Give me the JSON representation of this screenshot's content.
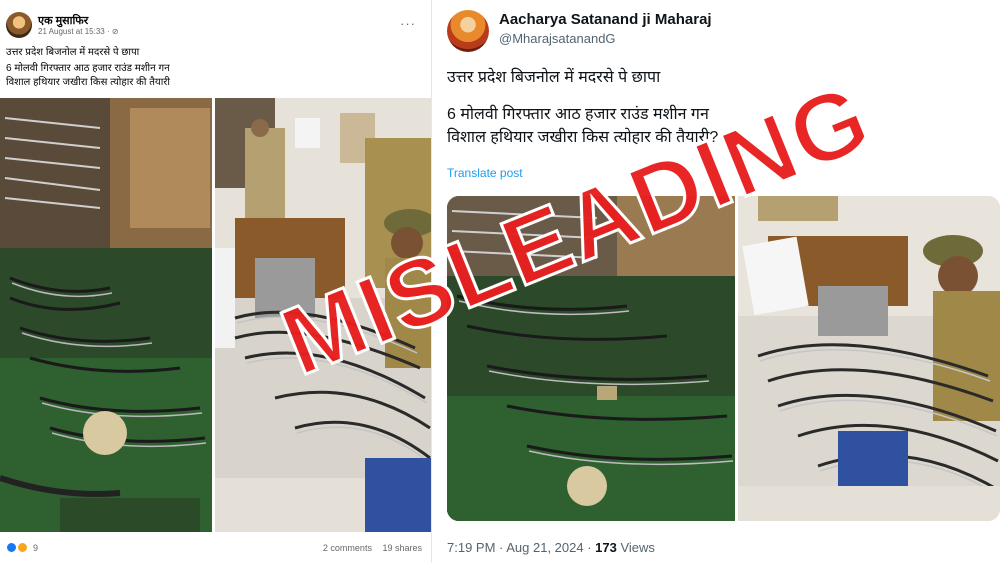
{
  "facebook_post": {
    "author": "एक मुसाफिर",
    "meta": "21 August at 15:33 · ⊘",
    "more_label": "···",
    "text_line1": "उत्तर प्रदेश बिजनोल में मदरसे पे छापा",
    "text_line2": "6 मोलवी गिरफ्तार आठ हजार राउंड मशीन गन",
    "text_line3": "विशाल हथियार जखीरा किस त्योहार की तैयारी",
    "reaction_count": "9",
    "comments": "2 comments",
    "shares": "19 shares"
  },
  "tweet": {
    "name": "Aacharya Satanand ji Maharaj",
    "handle": "@MharajsatanandG",
    "text_line1": "उत्तर प्रदेश बिजनोल में मदरसे पे छापा",
    "text_line2": "6 मोलवी गिरफ्तार आठ हजार राउंड मशीन गन",
    "text_line3": "विशाल हथियार जखीरा किस त्योहार की तैयारी?",
    "translate_label": "Translate post",
    "timestamp": "7:19 PM · Aug 21, 2024 · ",
    "views_count": "173",
    "views_label": " Views"
  },
  "stamp": {
    "label": "MISLEADING",
    "color": "#e61414"
  },
  "icons": [
    "like-reaction-icon",
    "angry-reaction-icon",
    "more-options-icon"
  ]
}
